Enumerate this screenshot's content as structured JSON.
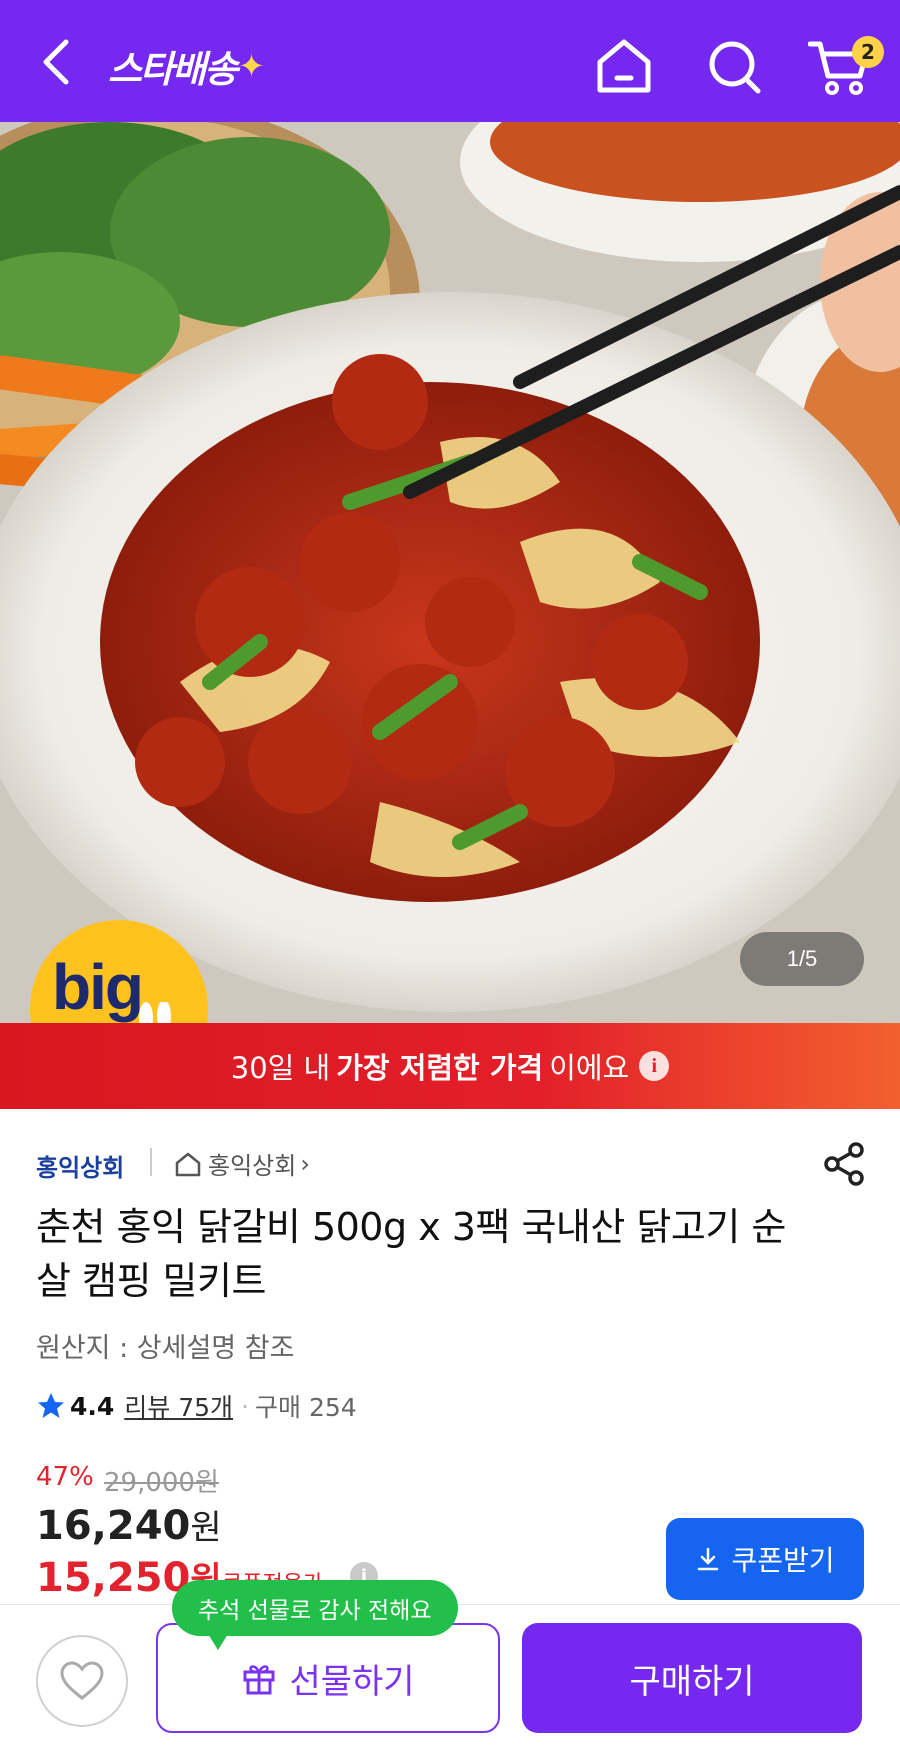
{
  "header": {
    "back_icon": "chevron-left-icon",
    "logo": "스타배송",
    "home_icon": "home-icon",
    "search_icon": "search-icon",
    "cart_icon": "cart-icon",
    "cart_count": "2",
    "color": "#7428f0"
  },
  "hero": {
    "badge_big": "big",
    "badge_sale": "sale",
    "counter": "1/5"
  },
  "banner": {
    "prefix": "30일 내",
    "highlight": "가장 저렴한 가격",
    "suffix": "이에요",
    "info_icon": "i"
  },
  "seller": {
    "name": "홍익상회",
    "store": "홍익상회",
    "store_arrow": "›",
    "share_icon": "share-icon"
  },
  "product": {
    "title": "춘천 홍익 닭갈비 500g x 3팩 국내산 닭고기 순살 캠핑 밀키트",
    "origin": "원산지 : 상세설명 참조"
  },
  "rating": {
    "score": "4.4",
    "reviews": "리뷰 75개",
    "separator": "·",
    "purchases": "구매 254"
  },
  "price": {
    "discount": "47%",
    "original": "29,000원",
    "sale_amount": "16,240",
    "sale_unit": "원",
    "coupon_amount": "15,250",
    "coupon_unit": "원",
    "coupon_label": "쿠폰적용가",
    "coupon_info": "i",
    "coupon_button": "쿠폰받기"
  },
  "bottom": {
    "tooltip": "추석 선물로 감사 전해요",
    "gift_button": "선물하기",
    "buy_button": "구매하기"
  }
}
